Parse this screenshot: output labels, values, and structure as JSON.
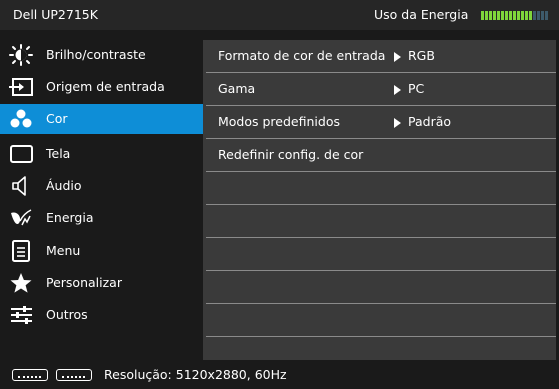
{
  "header": {
    "title": "Dell UP2715K",
    "energy_label": "Uso da Energia",
    "energy_level": 0.78,
    "energy_active_color": "#7fd63b",
    "energy_inactive_color": "#3d5a6b"
  },
  "sidebar": {
    "items": [
      {
        "label": "Brilho/contraste",
        "icon": "brightness-icon"
      },
      {
        "label": "Origem de entrada",
        "icon": "input-source-icon"
      },
      {
        "label": "Cor",
        "icon": "color-icon",
        "active": true
      },
      {
        "label": "Tela",
        "icon": "display-icon"
      },
      {
        "label": "Áudio",
        "icon": "speaker-icon"
      },
      {
        "label": "Energia",
        "icon": "energy-icon"
      },
      {
        "label": "Menu",
        "icon": "menu-icon"
      },
      {
        "label": "Personalizar",
        "icon": "star-icon"
      },
      {
        "label": "Outros",
        "icon": "sliders-icon"
      }
    ],
    "active_color": "#0e8ed7"
  },
  "main": {
    "rows": [
      {
        "label": "Formato de cor de entrada",
        "value": "RGB"
      },
      {
        "label": "Gama",
        "value": "PC"
      },
      {
        "label": "Modos predefinidos",
        "value": "Padrão"
      },
      {
        "label": "Redefinir config. de cor",
        "value": ""
      },
      {
        "label": "",
        "value": ""
      },
      {
        "label": "",
        "value": ""
      },
      {
        "label": "",
        "value": ""
      },
      {
        "label": "",
        "value": ""
      },
      {
        "label": "",
        "value": ""
      }
    ]
  },
  "status": {
    "resolution": "Resolução: 5120x2880, 60Hz"
  }
}
